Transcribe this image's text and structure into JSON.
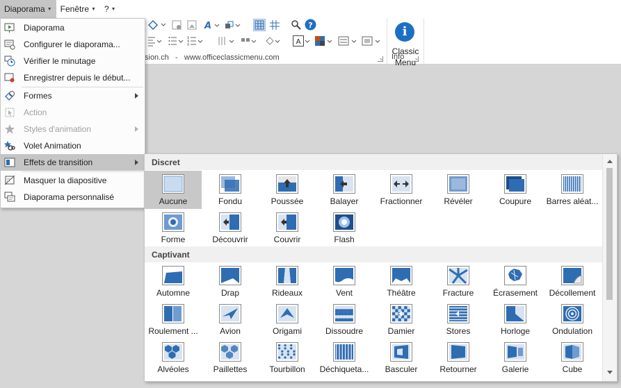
{
  "menubar": {
    "items": [
      {
        "label": "Diaporama",
        "active": true
      },
      {
        "label": "Fenêtre",
        "active": false
      },
      {
        "label": "?",
        "active": false
      }
    ]
  },
  "ribbon": {
    "text_left": "sion.ch",
    "text_sep": "-",
    "text_url": "www.officeclassicmenu.com",
    "classic_menu_line1": "Classic",
    "classic_menu_line2": "Menu",
    "info_label": "Info"
  },
  "dropdown": {
    "items": [
      {
        "label": "Diaporama",
        "icon": "slideshow-play-icon",
        "disabled": false,
        "submenu": false,
        "highlighted": false
      },
      {
        "label": "Configurer le diaporama...",
        "icon": "setup-slideshow-icon",
        "disabled": false,
        "submenu": false,
        "highlighted": false
      },
      {
        "label": "Vérifier le minutage",
        "icon": "rehearse-timings-icon",
        "disabled": false,
        "submenu": false,
        "highlighted": false
      },
      {
        "label": "Enregistrer depuis le début...",
        "icon": "record-slideshow-icon",
        "disabled": false,
        "submenu": false,
        "highlighted": false
      },
      {
        "label": "Formes",
        "icon": "shapes-icon",
        "disabled": false,
        "submenu": true,
        "highlighted": false
      },
      {
        "label": "Action",
        "icon": "action-icon",
        "disabled": true,
        "submenu": false,
        "highlighted": false
      },
      {
        "label": "Styles d'animation",
        "icon": "animation-styles-icon",
        "disabled": true,
        "submenu": true,
        "highlighted": false
      },
      {
        "label": "Volet Animation",
        "icon": "animation-pane-icon",
        "disabled": false,
        "submenu": false,
        "highlighted": false
      },
      {
        "label": "Effets de transition",
        "icon": "transition-effects-icon",
        "disabled": false,
        "submenu": true,
        "highlighted": true
      },
      {
        "label": "Masquer la diapositive",
        "icon": "hide-slide-icon",
        "disabled": false,
        "submenu": false,
        "highlighted": false
      },
      {
        "label": "Diaporama personnalisé",
        "icon": "custom-slideshow-icon",
        "disabled": false,
        "submenu": false,
        "highlighted": false
      }
    ]
  },
  "gallery": {
    "sections": [
      {
        "header": "Discret",
        "items": [
          "Aucune",
          "Fondu",
          "Poussée",
          "Balayer",
          "Fractionner",
          "Révéler",
          "Coupure",
          "Barres aléat...",
          "Forme",
          "Découvrir",
          "Couvrir",
          "Flash"
        ]
      },
      {
        "header": "Captivant",
        "items": [
          "Automne",
          "Drap",
          "Rideaux",
          "Vent",
          "Théâtre",
          "Fracture",
          "Écrasement",
          "Décollement",
          "Roulement ...",
          "Avion",
          "Origami",
          "Dissoudre",
          "Damier",
          "Stores",
          "Horloge",
          "Ondulation",
          "Alvéoles",
          "Paillettes",
          "Tourbillon",
          "Déchiqueta...",
          "Basculer",
          "Retourner",
          "Galerie",
          "Cube"
        ]
      }
    ],
    "selected": "Aucune"
  },
  "colors": {
    "accent": "#1e6fc3",
    "menu_highlight": "#c5c5c5",
    "thumb_blue": "#2f6db3"
  }
}
